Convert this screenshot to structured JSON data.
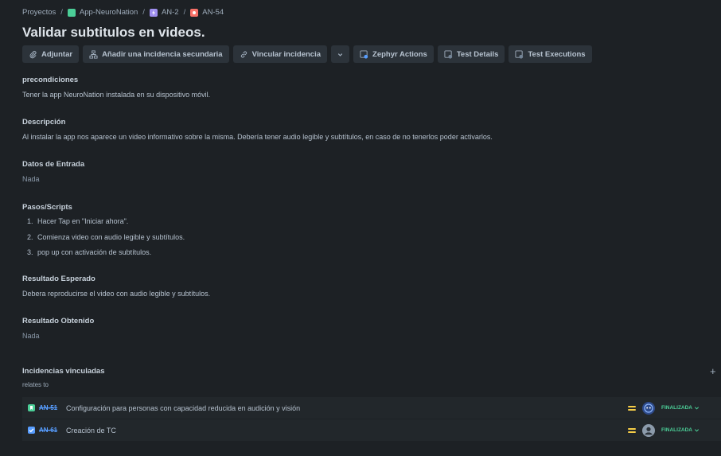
{
  "breadcrumb": {
    "projects": "Proyectos",
    "project": "App-NeuroNation",
    "epic": "AN-2",
    "issue": "AN-54",
    "separator": "/"
  },
  "issue": {
    "title": "Validar subtitulos en videos."
  },
  "toolbar": {
    "attach": "Adjuntar",
    "child": "Añadir una incidencia secundaria",
    "link": "Vincular incidencia",
    "zephyr": "Zephyr Actions",
    "test_details": "Test Details",
    "test_executions": "Test Executions"
  },
  "sections": {
    "preconditions": {
      "heading": "precondiciones",
      "text": "Tener la app NeuroNation instalada en su dispositivo móvil."
    },
    "description": {
      "heading": "Descripción",
      "text": "Al instalar la app nos aparece un video informativo sobre la misma. Debería tener audio legible y subtítulos, en caso de no tenerlos poder activarlos."
    },
    "input": {
      "heading": "Datos de Entrada",
      "text": "Nada"
    },
    "steps": {
      "heading": "Pasos/Scripts",
      "items": [
        {
          "num": "1.",
          "text": "Hacer Tap en \"Iniciar ahora\"."
        },
        {
          "num": "2.",
          "text": "Comienza video con audio legible y subtítulos."
        },
        {
          "num": "3.",
          "text": "pop up con activación de subtítulos."
        }
      ]
    },
    "expected": {
      "heading": "Resultado Esperado",
      "text": "Debera reproducirse el video con audio legible y subtítulos."
    },
    "actual": {
      "heading": "Resultado Obtenido",
      "text": "Nada"
    }
  },
  "linked": {
    "heading": "Incidencias vinculadas",
    "add": "+",
    "relation": "relates to",
    "items": [
      {
        "key": "AN-51",
        "summary": "Configuración para personas con capacidad reducida en audición y visión",
        "status": "FINALIZADA"
      },
      {
        "key": "AN-61",
        "summary": "Creación de TC",
        "status": "FINALIZADA"
      }
    ]
  },
  "colors": {
    "background": "#1d2125",
    "link": "#579dff",
    "done": "#4bce97",
    "priority": "#f5cd47"
  }
}
